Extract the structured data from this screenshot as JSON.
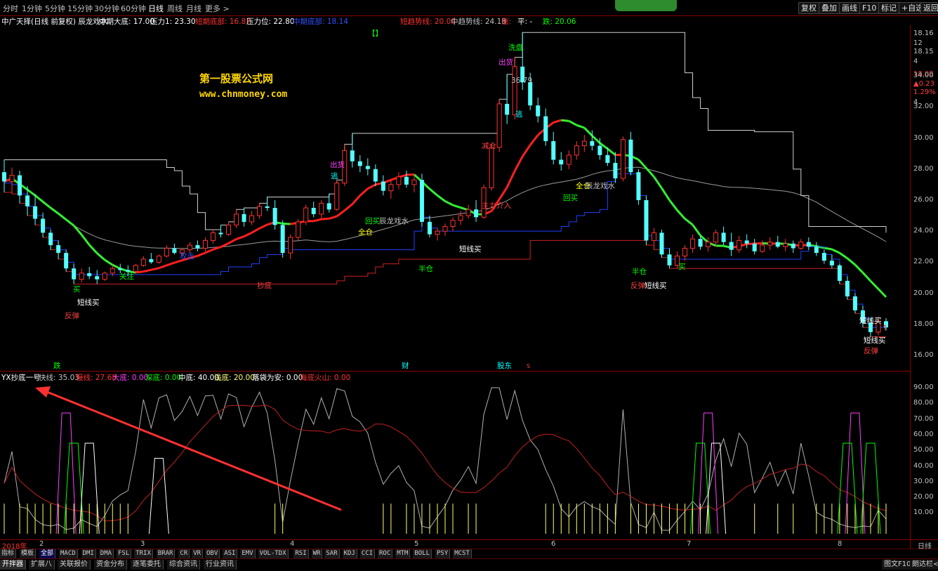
{
  "periods": [
    "分时",
    "1分钟",
    "5分钟",
    "15分钟",
    "30分钟",
    "60分钟",
    "日线",
    "周线",
    "月线",
    "更多 >"
  ],
  "active_period": "日线",
  "toolbar_right": [
    "复权",
    "叠加",
    "画线",
    "F10",
    "标记",
    "+自选",
    "返回"
  ],
  "info": {
    "title": "中广天择(日线 前复权) 辰龙戏水",
    "mid_bottom_label": "中期大底: 17.00",
    "pressure1_label": "压力1: 23.30",
    "short_bottom_label": "短期底部: 16.87",
    "pressure_label": "压力位: 22.80",
    "mid_bottom2_label": "中期底部: 18.14",
    "short_trend_label": "短趋势线: 20.06",
    "mid_trend_label": "中趋势线: 24.18",
    "up_label": "涨:",
    "flat_label": "平: -",
    "down_label": "跌: 20.06"
  },
  "watermark": {
    "line1": "第一股票公式网",
    "line2": "www.chnmoney.com"
  },
  "annotations": {
    "bracket": "【】",
    "washout": "洗盘",
    "ship1": "出货",
    "ship2": "出货",
    "escape1": "逃",
    "escape2": "逃",
    "high_price": "36.79",
    "reduce": "减仓",
    "main_in": "主力介入",
    "full1": "全仓",
    "full2": "全仓",
    "buyback1": "回买",
    "buyback2": "回买",
    "dragon1": "辰龙戏水",
    "dragon2": "辰龙戏水",
    "half1": "半仓",
    "half2": "半仓",
    "short_buy1": "短线买",
    "short_buy2": "短线买",
    "short_buy3": "短线买",
    "short_buy4": "短线买",
    "short_buy5": "短线买",
    "rebound1": "反弹",
    "rebound2": "反弹",
    "rebound3": "反弹",
    "attack": "攻击",
    "buy": "买",
    "buy2": "买",
    "bottom_buy": "抄底",
    "concern": "关注",
    "up_arrow_mark": "↑",
    "ev_down": "跌",
    "ev_finance": "财",
    "ev_shareholder": "股东",
    "ev_s": "S"
  },
  "price_axis": {
    "top_ticks": [
      "18.16",
      "12",
      "18.15",
      "4",
      "18.08",
      "▲0.23",
      "1.29%",
      "4"
    ],
    "ticks": [
      "34.00",
      "32.00",
      "30.00",
      "28.00",
      "26.00",
      "24.00",
      "22.00",
      "20.00",
      "18.00",
      "16.00"
    ]
  },
  "indicator_info": {
    "name": "YX抄底一号",
    "fast": "快线: 35.03",
    "slow": "慢线: 27.68",
    "big_bottom": "大底: 0.00",
    "deep_bottom": "深底: 0.00",
    "mid_bottom": "中底: 40.00",
    "shallow_bottom": "浅底: 20.00",
    "bag_safe": "落袋为安: 0.00",
    "sea_volcano": "海底火山: 0.00"
  },
  "indicator_axis": [
    "90.00",
    "80.00",
    "70.00",
    "60.00",
    "50.00",
    "40.00",
    "30.00",
    "20.00",
    "10.00"
  ],
  "dates": [
    "2018年",
    "2",
    "3",
    "4",
    "5",
    "6",
    "7",
    "8"
  ],
  "right_bottom_label": "日线",
  "indicator_tabs": [
    "指标",
    "模板",
    "全部",
    "MACD",
    "DMI",
    "DMA",
    "FSL",
    "TRIX",
    "BRAR",
    "CR",
    "VR",
    "OBV",
    "ASI",
    "EMV",
    "VOL-TDX",
    "RSI",
    "WR",
    "SAR",
    "KDJ",
    "CCI",
    "ROC",
    "MTM",
    "BOLL",
    "PSY",
    "MCST"
  ],
  "active_indicator_tab": "全部",
  "bottom_tabs": [
    "开拌器",
    "扩展八",
    "关联报价",
    "资金分布",
    "逐笔委托",
    "综合资讯",
    "行业资讯"
  ],
  "bottom_right": [
    "图文F10",
    "朗达栏<"
  ],
  "chart_data": {
    "type": "candlestick",
    "y_axis": [
      16,
      35
    ],
    "candles": [
      [
        27.8,
        28.6,
        26.5,
        27.2
      ],
      [
        27.2,
        28.1,
        26.4,
        27.6
      ],
      [
        27.6,
        27.9,
        25.8,
        26.3
      ],
      [
        26.3,
        26.9,
        25.0,
        25.6
      ],
      [
        25.6,
        26.4,
        24.4,
        24.8
      ],
      [
        24.8,
        25.2,
        23.6,
        23.9
      ],
      [
        23.9,
        24.1,
        22.8,
        23.1
      ],
      [
        23.1,
        23.4,
        22.2,
        22.6
      ],
      [
        22.6,
        22.8,
        21.4,
        21.6
      ],
      [
        21.6,
        21.9,
        20.6,
        20.9
      ],
      [
        20.9,
        21.6,
        20.7,
        21.3
      ],
      [
        21.3,
        21.7,
        20.9,
        21.1
      ],
      [
        21.1,
        21.5,
        20.6,
        20.9
      ],
      [
        20.9,
        21.4,
        20.8,
        21.3
      ],
      [
        21.3,
        21.8,
        21.1,
        21.6
      ],
      [
        21.6,
        21.9,
        21.3,
        21.5
      ],
      [
        21.5,
        21.8,
        21.1,
        21.4
      ],
      [
        21.4,
        21.9,
        21.3,
        21.8
      ],
      [
        21.8,
        22.4,
        21.7,
        22.2
      ],
      [
        22.2,
        22.6,
        21.9,
        22.0
      ],
      [
        22.0,
        22.5,
        21.9,
        22.4
      ],
      [
        22.4,
        23.1,
        22.3,
        22.9
      ],
      [
        22.9,
        23.2,
        22.5,
        22.6
      ],
      [
        22.6,
        22.9,
        22.4,
        22.8
      ],
      [
        22.8,
        23.3,
        22.6,
        23.1
      ],
      [
        23.1,
        23.4,
        22.7,
        22.9
      ],
      [
        22.9,
        23.6,
        22.7,
        23.4
      ],
      [
        23.4,
        24.1,
        23.2,
        23.9
      ],
      [
        23.9,
        24.4,
        23.6,
        23.8
      ],
      [
        23.8,
        24.6,
        23.7,
        24.4
      ],
      [
        24.4,
        25.4,
        24.2,
        25.1
      ],
      [
        25.1,
        25.5,
        24.3,
        24.6
      ],
      [
        24.6,
        25.3,
        24.4,
        25.0
      ],
      [
        25.0,
        25.8,
        24.8,
        25.6
      ],
      [
        25.6,
        26.2,
        25.3,
        25.5
      ],
      [
        25.5,
        26.0,
        24.1,
        24.4
      ],
      [
        24.4,
        24.7,
        22.3,
        22.6
      ],
      [
        22.6,
        23.8,
        22.2,
        23.6
      ],
      [
        23.6,
        24.8,
        23.4,
        24.6
      ],
      [
        24.6,
        25.7,
        24.4,
        25.5
      ],
      [
        25.5,
        25.9,
        24.9,
        25.1
      ],
      [
        25.1,
        26.0,
        24.8,
        25.8
      ],
      [
        25.8,
        26.4,
        25.2,
        25.4
      ],
      [
        25.4,
        27.3,
        25.3,
        27.1
      ],
      [
        27.1,
        29.6,
        26.9,
        29.2
      ],
      [
        29.2,
        30.3,
        28.1,
        28.5
      ],
      [
        28.5,
        28.9,
        27.8,
        28.2
      ],
      [
        28.2,
        28.7,
        27.6,
        28.0
      ],
      [
        28.0,
        28.3,
        26.9,
        27.2
      ],
      [
        27.2,
        27.6,
        26.3,
        26.6
      ],
      [
        26.6,
        27.3,
        26.1,
        27.0
      ],
      [
        27.0,
        27.8,
        26.7,
        27.5
      ],
      [
        27.5,
        27.9,
        26.8,
        27.0
      ],
      [
        27.0,
        27.6,
        26.5,
        27.3
      ],
      [
        27.3,
        27.7,
        24.3,
        24.6
      ],
      [
        24.6,
        25.0,
        23.6,
        23.8
      ],
      [
        23.8,
        24.2,
        23.4,
        24.0
      ],
      [
        24.0,
        24.5,
        23.7,
        24.3
      ],
      [
        24.3,
        24.9,
        24.0,
        24.7
      ],
      [
        24.7,
        25.3,
        24.4,
        25.0
      ],
      [
        25.0,
        25.7,
        24.8,
        25.4
      ],
      [
        25.4,
        26.0,
        24.6,
        24.9
      ],
      [
        24.9,
        27.0,
        24.8,
        26.8
      ],
      [
        26.8,
        29.6,
        26.6,
        29.4
      ],
      [
        29.4,
        32.5,
        29.1,
        32.2
      ],
      [
        32.2,
        34.1,
        30.9,
        31.5
      ],
      [
        31.5,
        35.2,
        31.2,
        34.6
      ],
      [
        34.6,
        36.8,
        33.1,
        33.6
      ],
      [
        33.6,
        34.2,
        31.8,
        32.1
      ],
      [
        32.1,
        32.6,
        31.0,
        31.4
      ],
      [
        31.4,
        31.9,
        29.5,
        29.8
      ],
      [
        29.8,
        30.4,
        28.3,
        28.6
      ],
      [
        28.6,
        29.1,
        27.9,
        28.3
      ],
      [
        28.3,
        29.2,
        28.0,
        28.9
      ],
      [
        28.9,
        29.8,
        28.6,
        29.5
      ],
      [
        29.5,
        30.2,
        29.1,
        29.8
      ],
      [
        29.8,
        30.5,
        29.2,
        29.5
      ],
      [
        29.5,
        30.0,
        28.6,
        28.9
      ],
      [
        28.9,
        29.4,
        28.2,
        28.4
      ],
      [
        28.4,
        29.1,
        27.1,
        27.4
      ],
      [
        27.4,
        30.1,
        27.2,
        29.9
      ],
      [
        29.9,
        30.4,
        27.6,
        27.8
      ],
      [
        27.8,
        28.0,
        25.7,
        26.0
      ],
      [
        26.0,
        26.3,
        23.1,
        23.4
      ],
      [
        23.4,
        24.2,
        22.8,
        23.9
      ],
      [
        23.9,
        24.1,
        22.3,
        22.5
      ],
      [
        22.5,
        22.9,
        21.6,
        21.8
      ],
      [
        21.8,
        22.7,
        21.6,
        22.4
      ],
      [
        22.4,
        23.1,
        22.1,
        22.9
      ],
      [
        22.9,
        23.8,
        22.6,
        23.5
      ],
      [
        23.5,
        23.7,
        22.8,
        23.0
      ],
      [
        23.0,
        23.6,
        22.7,
        23.3
      ],
      [
        23.3,
        24.1,
        23.0,
        23.9
      ],
      [
        23.9,
        24.3,
        23.1,
        23.3
      ],
      [
        23.3,
        23.9,
        22.4,
        22.8
      ],
      [
        22.8,
        23.7,
        22.6,
        23.4
      ],
      [
        23.4,
        23.8,
        22.9,
        23.2
      ],
      [
        23.2,
        23.5,
        22.5,
        22.7
      ],
      [
        22.7,
        23.4,
        22.6,
        23.1
      ],
      [
        23.1,
        23.6,
        22.8,
        23.3
      ],
      [
        23.3,
        23.7,
        22.9,
        23.0
      ],
      [
        23.0,
        23.5,
        22.7,
        23.2
      ],
      [
        23.2,
        23.4,
        22.6,
        22.9
      ],
      [
        22.9,
        23.5,
        22.8,
        23.3
      ],
      [
        23.3,
        23.6,
        22.8,
        23.0
      ],
      [
        23.0,
        23.3,
        22.4,
        22.6
      ],
      [
        22.6,
        22.8,
        21.9,
        22.1
      ],
      [
        22.1,
        22.5,
        21.6,
        21.8
      ],
      [
        21.8,
        21.9,
        20.6,
        20.8
      ],
      [
        20.8,
        21.1,
        19.6,
        19.8
      ],
      [
        19.8,
        20.0,
        18.7,
        18.9
      ],
      [
        18.9,
        19.2,
        17.8,
        18.1
      ],
      [
        18.1,
        18.4,
        17.2,
        17.5
      ],
      [
        17.5,
        18.5,
        17.3,
        18.2
      ],
      [
        18.2,
        18.4,
        17.6,
        17.8
      ]
    ]
  }
}
